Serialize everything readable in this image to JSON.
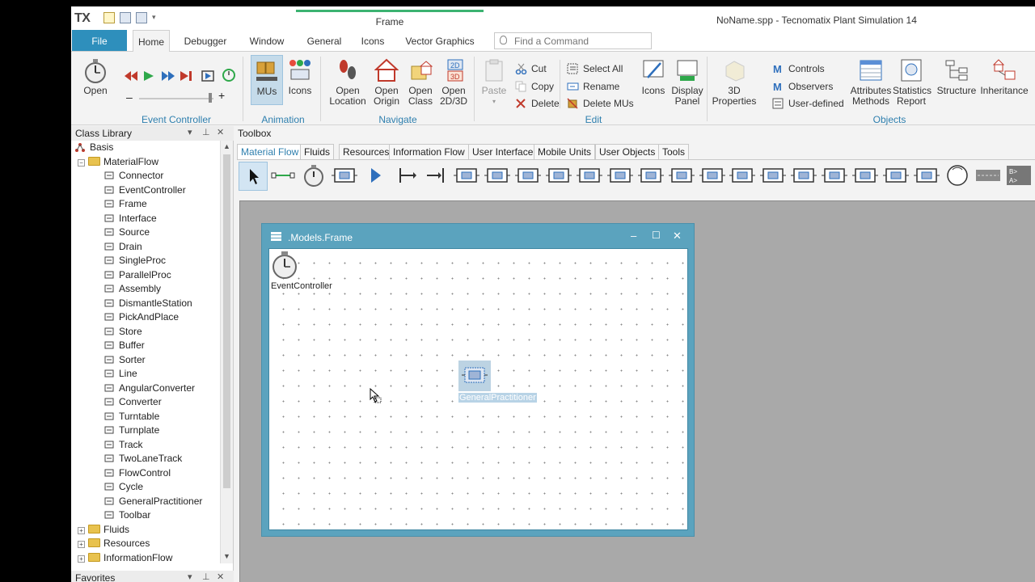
{
  "app": {
    "logo": "TX",
    "window_title": "NoName.spp - Tecnomatix Plant Simulation 14",
    "context_tab": "Frame"
  },
  "ribbon_tabs": [
    "File",
    "Home",
    "Debugger",
    "Window",
    "General",
    "Icons",
    "Vector Graphics"
  ],
  "search": {
    "placeholder": "Find a Command"
  },
  "ribbon": {
    "event_controller": {
      "open": "Open",
      "group": "Event Controller"
    },
    "animation": {
      "mus": "MUs",
      "icons": "Icons",
      "group": "Animation"
    },
    "navigate": {
      "open_location": [
        "Open",
        "Location"
      ],
      "open_origin": [
        "Open",
        "Origin"
      ],
      "open_class": [
        "Open",
        "Class"
      ],
      "open_2d3d": [
        "Open",
        "2D/3D"
      ],
      "group": "Navigate"
    },
    "edit": {
      "paste": "Paste",
      "cut": "Cut",
      "copy": "Copy",
      "delete": "Delete",
      "select_all": "Select All",
      "rename": "Rename",
      "delete_mus": "Delete MUs",
      "icons": "Icons",
      "display_panel": [
        "Display",
        "Panel"
      ],
      "group": "Edit"
    },
    "objects": {
      "properties_3d": [
        "3D",
        "Properties"
      ],
      "controls": "Controls",
      "observers": "Observers",
      "user_defined": "User-defined",
      "attributes_methods": [
        "Attributes",
        "Methods"
      ],
      "statistics_report": [
        "Statistics",
        "Report"
      ],
      "structure": "Structure",
      "inheritance": "Inheritance",
      "group": "Objects"
    }
  },
  "class_library": {
    "title": "Class Library",
    "items": [
      {
        "label": "Basis",
        "level": 0,
        "kind": "root"
      },
      {
        "label": "MaterialFlow",
        "level": 1,
        "kind": "folder-open"
      },
      {
        "label": "Connector",
        "level": 2,
        "icon": "connector-icon"
      },
      {
        "label": "EventController",
        "level": 2,
        "icon": "stopwatch-icon"
      },
      {
        "label": "Frame",
        "level": 2,
        "icon": "frame-icon"
      },
      {
        "label": "Interface",
        "level": 2,
        "icon": "interface-icon"
      },
      {
        "label": "Source",
        "level": 2,
        "icon": "source-icon"
      },
      {
        "label": "Drain",
        "level": 2,
        "icon": "drain-icon"
      },
      {
        "label": "SingleProc",
        "level": 2,
        "icon": "singleproc-icon"
      },
      {
        "label": "ParallelProc",
        "level": 2,
        "icon": "parallelproc-icon"
      },
      {
        "label": "Assembly",
        "level": 2,
        "icon": "assembly-icon"
      },
      {
        "label": "DismantleStation",
        "level": 2,
        "icon": "dismantle-icon"
      },
      {
        "label": "PickAndPlace",
        "level": 2,
        "icon": "pickandplace-icon"
      },
      {
        "label": "Store",
        "level": 2,
        "icon": "store-icon"
      },
      {
        "label": "Buffer",
        "level": 2,
        "icon": "buffer-icon"
      },
      {
        "label": "Sorter",
        "level": 2,
        "icon": "sorter-icon"
      },
      {
        "label": "Line",
        "level": 2,
        "icon": "line-icon"
      },
      {
        "label": "AngularConverter",
        "level": 2,
        "icon": "angularconverter-icon"
      },
      {
        "label": "Converter",
        "level": 2,
        "icon": "converter-icon"
      },
      {
        "label": "Turntable",
        "level": 2,
        "icon": "turntable-icon"
      },
      {
        "label": "Turnplate",
        "level": 2,
        "icon": "turnplate-icon"
      },
      {
        "label": "Track",
        "level": 2,
        "icon": "track-icon"
      },
      {
        "label": "TwoLaneTrack",
        "level": 2,
        "icon": "twolanetrack-icon"
      },
      {
        "label": "FlowControl",
        "level": 2,
        "icon": "flowcontrol-icon"
      },
      {
        "label": "Cycle",
        "level": 2,
        "icon": "cycle-icon"
      },
      {
        "label": "GeneralPractitioner",
        "level": 2,
        "icon": "singleproc-icon"
      },
      {
        "label": "Toolbar",
        "level": 2,
        "icon": "toolbar-icon"
      },
      {
        "label": "Fluids",
        "level": 1,
        "kind": "folder"
      },
      {
        "label": "Resources",
        "level": 1,
        "kind": "folder"
      },
      {
        "label": "InformationFlow",
        "level": 1,
        "kind": "folder"
      }
    ]
  },
  "favorites": {
    "title": "Favorites"
  },
  "toolbox": {
    "title": "Toolbox",
    "tabs": [
      "Material Flow",
      "Fluids",
      "Resources",
      "Information Flow",
      "User Interface",
      "Mobile Units",
      "User Objects",
      "Tools"
    ],
    "active_tab": "Material Flow"
  },
  "frame_window": {
    "title": ".Models.Frame",
    "objects": [
      {
        "label": "EventController",
        "icon": "stopwatch-icon"
      },
      {
        "label": "GeneralPractitioner",
        "icon": "singleproc-icon",
        "selected": true
      }
    ]
  },
  "colors": {
    "accent": "#2e8fbc",
    "frame_border": "#5ba3be",
    "workspace": "#a9a9a9",
    "selection": "#c5dbea"
  }
}
